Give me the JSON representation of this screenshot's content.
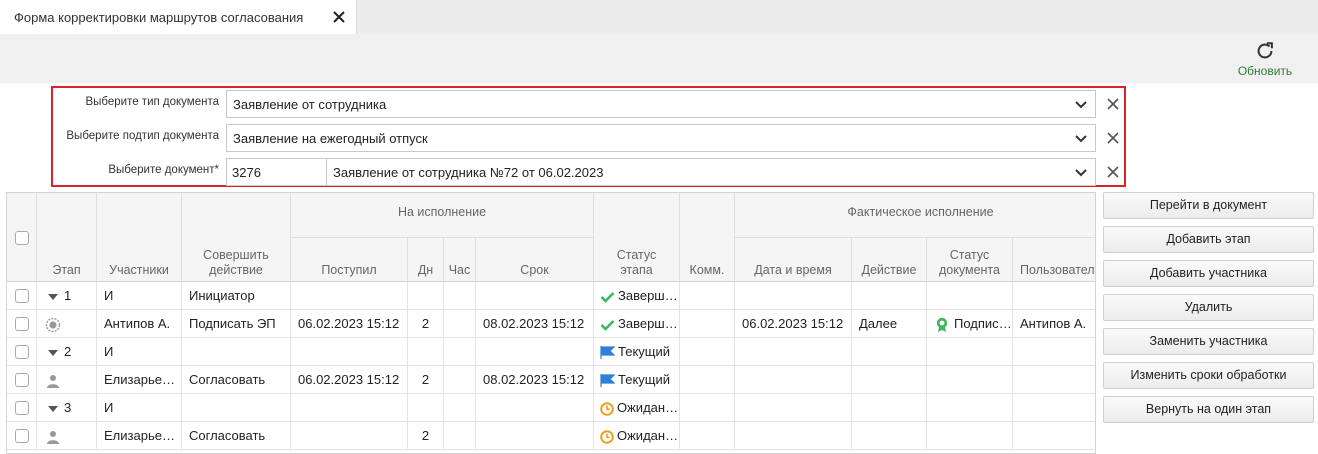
{
  "tab": {
    "title": "Форма корректировки маршрутов согласования"
  },
  "toolbar": {
    "refresh_label": "Обновить"
  },
  "filters": {
    "doc_type_label": "Выберите тип документа",
    "doc_type_value": "Заявление от сотрудника",
    "doc_subtype_label": "Выберите подтип документа",
    "doc_subtype_value": "Заявление на ежегодный отпуск",
    "document_label": "Выберите документ*",
    "document_number": "3276",
    "document_value": "Заявление от сотрудника №72 от 06.02.2023"
  },
  "table": {
    "group_headers": {
      "execution": "На исполнение",
      "actual": "Фактическое исполнение"
    },
    "headers": {
      "stage": "Этап",
      "participants": "Участники",
      "action_l1": "Совершить",
      "action_l2": "действие",
      "received": "Поступил",
      "days": "Дн",
      "hours": "Час",
      "deadline": "Срок",
      "status_l1": "Статус",
      "status_l2": "этапа",
      "comments": "Комм.",
      "datetime": "Дата и время",
      "act": "Действие",
      "docstatus_l1": "Статус",
      "docstatus_l2": "документа",
      "user": "Пользователь"
    },
    "rows": [
      {
        "stage": "1",
        "participants": "И",
        "action": "Инициатор",
        "received": "",
        "days": "",
        "deadline": "",
        "status": "Завершен",
        "datetime": "",
        "act": "",
        "docstatus": "",
        "user": ""
      },
      {
        "stage": "",
        "participants": "Антипов А.",
        "action": "Подписать ЭП",
        "received": "06.02.2023 15:12",
        "days": "2",
        "deadline": "08.02.2023 15:12",
        "status": "Завершен",
        "datetime": "06.02.2023 15:12",
        "act": "Далее",
        "docstatus": "Подписан",
        "user": "Антипов А."
      },
      {
        "stage": "2",
        "participants": "И",
        "action": "",
        "received": "",
        "days": "",
        "deadline": "",
        "status": "Текущий",
        "datetime": "",
        "act": "",
        "docstatus": "",
        "user": ""
      },
      {
        "stage": "",
        "participants": "Елизарьев А.",
        "action": "Согласовать",
        "received": "06.02.2023 15:12",
        "days": "2",
        "deadline": "08.02.2023 15:12",
        "status": "Текущий",
        "datetime": "",
        "act": "",
        "docstatus": "",
        "user": ""
      },
      {
        "stage": "3",
        "participants": "И",
        "action": "",
        "received": "",
        "days": "",
        "deadline": "",
        "status": "Ожидание",
        "datetime": "",
        "act": "",
        "docstatus": "",
        "user": ""
      },
      {
        "stage": "",
        "participants": "Елизарьев А.",
        "action": "Согласовать",
        "received": "",
        "days": "2",
        "deadline": "",
        "status": "Ожидание",
        "datetime": "",
        "act": "",
        "docstatus": "",
        "user": ""
      }
    ]
  },
  "actions": {
    "open_document": "Перейти в документ",
    "add_stage": "Добавить этап",
    "add_participant": "Добавить участника",
    "delete": "Удалить",
    "replace_participant": "Заменить участника",
    "change_deadlines": "Изменить сроки обработки",
    "step_back": "Вернуть на один этап"
  },
  "colors": {
    "accent_red": "#d9252a",
    "done_green": "#3cb95f",
    "current_blue": "#2f7fd8",
    "wait_orange": "#f0a020",
    "refresh_green": "#2e7d32"
  }
}
